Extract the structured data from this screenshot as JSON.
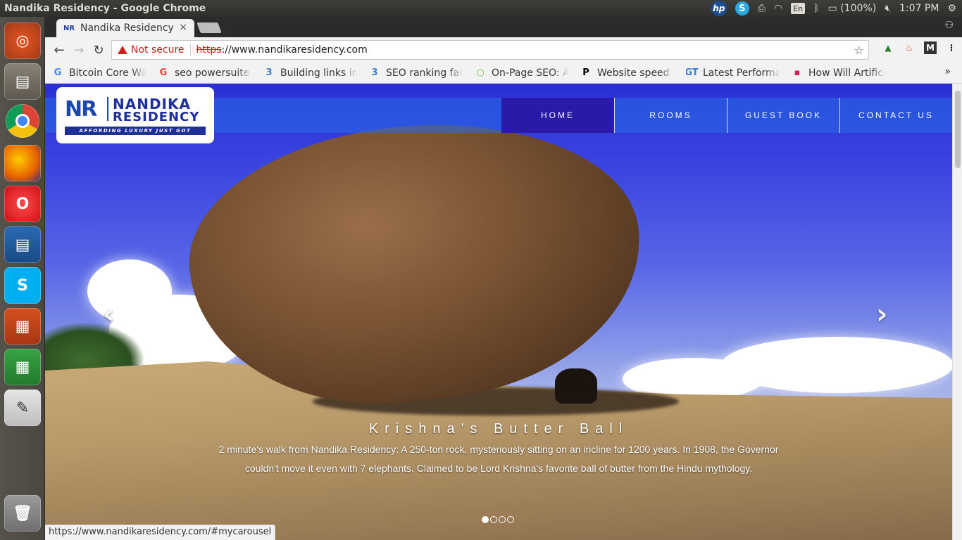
{
  "window": {
    "title": "Nandika Residency - Google Chrome"
  },
  "indicators": {
    "language": "En",
    "battery": "(100%)",
    "time": "1:07 PM"
  },
  "launcher": {
    "apps": [
      "ubuntu-dash",
      "files",
      "chrome",
      "firefox",
      "opera",
      "libreoffice-writer",
      "skype",
      "libreoffice-impress",
      "libreoffice-calc",
      "text-editor",
      "trash"
    ]
  },
  "tab": {
    "title": "Nandika Residency",
    "close": "×"
  },
  "omnibox": {
    "security": "Not secure",
    "scheme": "https",
    "rest": "://www.nandikaresidency.com"
  },
  "bookmarks": [
    {
      "label": "Bitcoin Core Wal",
      "icon": "G",
      "color": "#4285f4"
    },
    {
      "label": "seo powersuite c",
      "icon": "G",
      "color": "#ea4335"
    },
    {
      "label": "Building links in",
      "icon": "3",
      "color": "#3b7bd4"
    },
    {
      "label": "SEO ranking fact",
      "icon": "3",
      "color": "#3b7bd4"
    },
    {
      "label": "On-Page SEO: An",
      "icon": "○",
      "color": "#6cc04a"
    },
    {
      "label": "Website speed te",
      "icon": "P",
      "color": "#000"
    },
    {
      "label": "Latest Performa",
      "icon": "GT",
      "color": "#3b7bd4"
    },
    {
      "label": "How Will Artifici",
      "icon": "▪",
      "color": "#d81b60"
    }
  ],
  "site": {
    "logo": {
      "mark": "NR",
      "line1": "NANDIKA",
      "line2": "RESIDENCY",
      "tagline": "AFFORDING LUXURY JUST GOT SIMPLER"
    },
    "nav": [
      "HOME",
      "ROOMS",
      "GUEST BOOK",
      "CONTACT US"
    ],
    "caption": {
      "title": "Krishna's Butter Ball",
      "text": "2 minute's walk from Nandika Residency: A 250-ton rock, mysteriously sitting on an incline for 1200 years. In 1908, the Governor couldn't move it even with 7 elephants. Claimed to be Lord Krishna's favorite ball of butter from the Hindu mythology."
    },
    "carousel": {
      "slides": 4,
      "active": 1
    }
  },
  "status_url": "https://www.nandikaresidency.com/#mycarousel"
}
